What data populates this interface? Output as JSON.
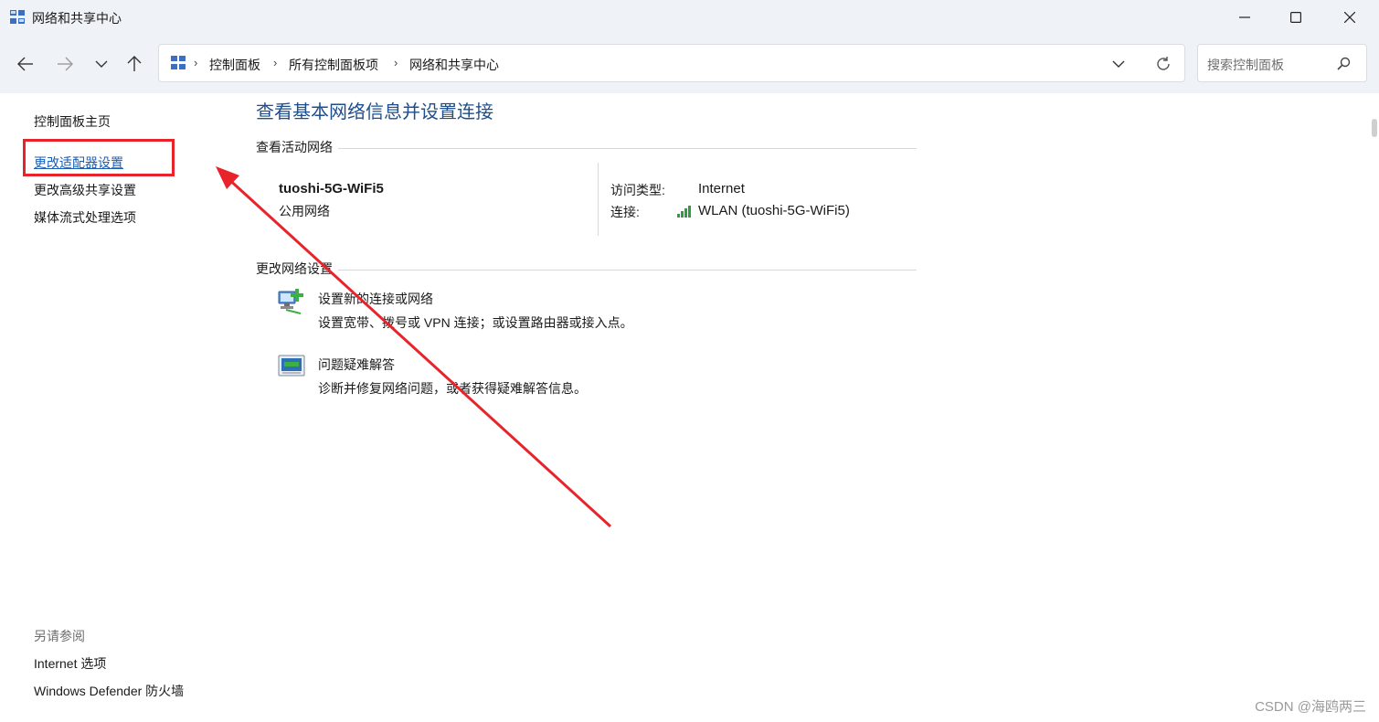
{
  "window": {
    "title": "网络和共享中心",
    "controls": [
      "minimize",
      "maximize",
      "close"
    ]
  },
  "nav": {
    "breadcrumbs": [
      "控制面板",
      "所有控制面板项",
      "网络和共享中心"
    ],
    "search_placeholder": "搜索控制面板"
  },
  "sidebar": {
    "links": [
      "控制面板主页",
      "更改适配器设置",
      "更改高级共享设置",
      "媒体流式处理选项"
    ],
    "see_also_title": "另请参阅",
    "see_also": [
      "Internet 选项",
      "Windows Defender 防火墙"
    ]
  },
  "main": {
    "page_title": "查看基本网络信息并设置连接",
    "active_networks_title": "查看活动网络",
    "network": {
      "name": "tuoshi-5G-WiFi5",
      "category": "公用网络",
      "access_type_label": "访问类型:",
      "access_type_value": "Internet",
      "connection_label": "连接:",
      "connection_value": "WLAN (tuoshi-5G-WiFi5)"
    },
    "change_settings_title": "更改网络设置",
    "tasks": [
      {
        "link": "设置新的连接或网络",
        "desc": "设置宽带、拨号或 VPN 连接；或设置路由器或接入点。"
      },
      {
        "link": "问题疑难解答",
        "desc": "诊断并修复网络问题，或者获得疑难解答信息。"
      }
    ]
  },
  "annotation": {
    "color": "#e8232a"
  },
  "watermark": "CSDN @海鸥两三",
  "colors": {
    "link": "#1a5fb4",
    "heading": "#1e4e8c",
    "chrome": "#eff3f7"
  }
}
